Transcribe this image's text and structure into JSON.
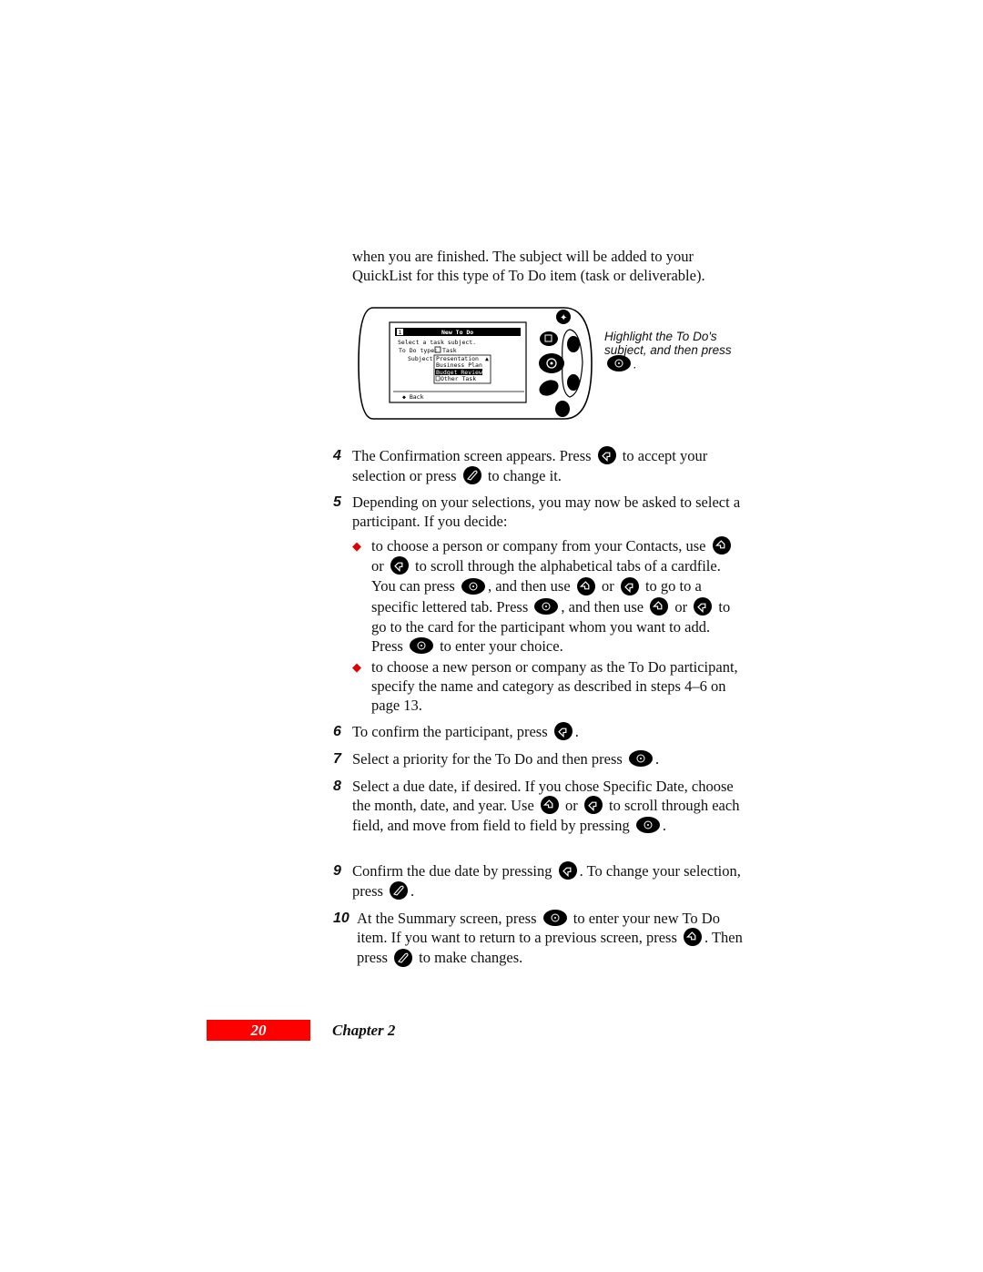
{
  "intro": {
    "line1": "when you are finished. The subject will be added to your",
    "line2": "QuickList for this type of To Do item (task or deliverable)."
  },
  "figure": {
    "screen_title": "New To Do",
    "screen_page": "1",
    "prompt": "Select a task subject.",
    "todo_type_label": "To Do type:",
    "todo_type_value": "Task",
    "subject_label": "Subject:",
    "subject_options": [
      "Presentation",
      "Business Plan",
      "Budget Review",
      "Other Task"
    ],
    "selected_option": "Budget Review",
    "back_label": "Back",
    "caption": "Highlight the To Do's subject, and then press",
    "caption_end": "."
  },
  "steps": [
    {
      "num": "4",
      "parts": [
        "The Confirmation screen appears. Press",
        "to accept your selection or press",
        "to change it."
      ]
    },
    {
      "num": "5",
      "parts": [
        "Depending on your selections, you may now be asked to select a participant. If you decide:"
      ]
    },
    {
      "num": "6",
      "parts": [
        "To confirm the participant, press",
        "."
      ]
    },
    {
      "num": "7",
      "parts": [
        "Select a priority for the To Do and then press",
        "."
      ]
    },
    {
      "num": "8",
      "parts": [
        "Select a due date, if desired. If you chose Specific Date, choose the month, date, and year. Use",
        "or",
        "to scroll through each field, and move from field to field by pressing",
        "."
      ]
    },
    {
      "num": "9",
      "parts": [
        "Confirm the due date by pressing",
        ". To change your selection, press",
        "."
      ]
    },
    {
      "num": "10",
      "parts": [
        "At the Summary screen, press",
        "to enter your new To Do item. If you want to return to a previous screen, press",
        ". Then press",
        "to make changes."
      ]
    }
  ],
  "bullets": [
    {
      "parts": [
        "to choose a person or company from your Contacts, use",
        "or",
        "to scroll through the alphabetical tabs of a cardfile. You can press",
        ", and then use",
        "or",
        "to go to a specific lettered tab. Press",
        ", and then use",
        "or",
        "to go to the card for the participant whom you want to add. Press",
        "to enter your choice."
      ]
    },
    {
      "parts": [
        "to choose a new person or company as the To Do participant, specify the name and category as described in steps 4–6 on page 13."
      ]
    }
  ],
  "footer": {
    "page_number": "20",
    "chapter": "Chapter 2"
  },
  "colors": {
    "accent": "#ff0000",
    "bullet": "#e00000"
  },
  "icons": {
    "back": "back-button-icon",
    "next": "next-button-icon",
    "enter": "enter-button-icon",
    "edit": "edit-button-icon"
  }
}
